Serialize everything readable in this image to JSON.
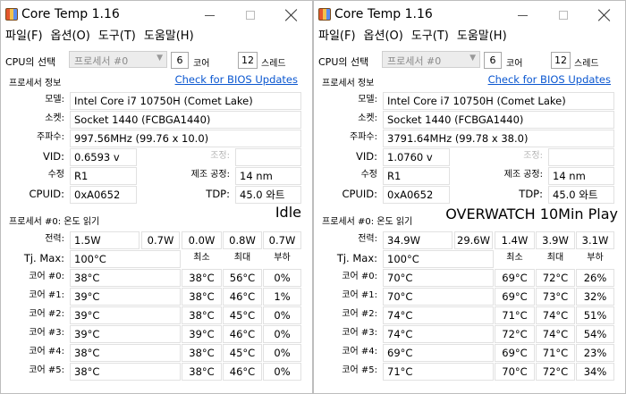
{
  "windows": [
    {
      "title": "Core Temp 1.16",
      "menu": [
        "파일(F)",
        "옵션(O)",
        "도구(T)",
        "도움말(H)"
      ],
      "cpu_select_label": "CPU의 선택",
      "cpu_select_value": "프로세서 #0",
      "cores_value": "6",
      "cores_label": "코어",
      "threads_value": "12",
      "threads_label": "스레드",
      "processor_info_label": "프로세서 정보",
      "bios_link": "Check for BIOS Updates",
      "model_label": "모델:",
      "model_value": "Intel Core i7 10750H (Comet Lake)",
      "socket_label": "소켓:",
      "socket_value": "Socket 1440 (FCBGA1440)",
      "freq_label": "주파수:",
      "freq_value": "997.56MHz (99.76 x 10.0)",
      "vid_label": "VID:",
      "vid_value": "0.6593 v",
      "rev_label": "수정",
      "rev_value": "R1",
      "cpuid_label": "CPUID:",
      "cpuid_value": "0xA0652",
      "modulation_label": "조정:",
      "modulation_value": "",
      "process_label": "제조 공정:",
      "process_value": "14 nm",
      "tdp_label": "TDP:",
      "tdp_value": "45.0 와트",
      "temp_section_label": "프로세서 #0: 온도 읽기",
      "power_label": "전력:",
      "power_values": [
        "1.5W",
        "0.7W",
        "0.0W",
        "0.8W",
        "0.7W"
      ],
      "tjmax_label": "Tj. Max:",
      "tjmax_value": "100°C",
      "col_min": "최소",
      "col_max": "최대",
      "col_load": "부하",
      "cores": [
        {
          "label": "코어 #0:",
          "temp": "38°C",
          "min": "38°C",
          "max": "56°C",
          "load": "0%"
        },
        {
          "label": "코어 #1:",
          "temp": "39°C",
          "min": "38°C",
          "max": "46°C",
          "load": "1%"
        },
        {
          "label": "코어 #2:",
          "temp": "39°C",
          "min": "38°C",
          "max": "45°C",
          "load": "0%"
        },
        {
          "label": "코어 #3:",
          "temp": "39°C",
          "min": "39°C",
          "max": "46°C",
          "load": "0%"
        },
        {
          "label": "코어 #4:",
          "temp": "38°C",
          "min": "38°C",
          "max": "45°C",
          "load": "0%"
        },
        {
          "label": "코어 #5:",
          "temp": "38°C",
          "min": "38°C",
          "max": "46°C",
          "load": "0%"
        }
      ],
      "overlay_label": "Idle"
    },
    {
      "title": "Core Temp 1.16",
      "menu": [
        "파일(F)",
        "옵션(O)",
        "도구(T)",
        "도움말(H)"
      ],
      "cpu_select_label": "CPU의 선택",
      "cpu_select_value": "프로세서 #0",
      "cores_value": "6",
      "cores_label": "코어",
      "threads_value": "12",
      "threads_label": "스레드",
      "processor_info_label": "프로세서 정보",
      "bios_link": "Check for BIOS Updates",
      "model_label": "모델:",
      "model_value": "Intel Core i7 10750H (Comet Lake)",
      "socket_label": "소켓:",
      "socket_value": "Socket 1440 (FCBGA1440)",
      "freq_label": "주파수:",
      "freq_value": "3791.64MHz (99.78 x 38.0)",
      "vid_label": "VID:",
      "vid_value": "1.0760 v",
      "rev_label": "수정",
      "rev_value": "R1",
      "cpuid_label": "CPUID:",
      "cpuid_value": "0xA0652",
      "modulation_label": "조정:",
      "modulation_value": "",
      "process_label": "제조 공정:",
      "process_value": "14 nm",
      "tdp_label": "TDP:",
      "tdp_value": "45.0 와트",
      "temp_section_label": "프로세서 #0: 온도 읽기",
      "power_label": "전력:",
      "power_values": [
        "34.9W",
        "29.6W",
        "1.4W",
        "3.9W",
        "3.1W"
      ],
      "tjmax_label": "Tj. Max:",
      "tjmax_value": "100°C",
      "col_min": "최소",
      "col_max": "최대",
      "col_load": "부하",
      "cores": [
        {
          "label": "코어 #0:",
          "temp": "70°C",
          "min": "69°C",
          "max": "72°C",
          "load": "26%"
        },
        {
          "label": "코어 #1:",
          "temp": "70°C",
          "min": "69°C",
          "max": "73°C",
          "load": "32%"
        },
        {
          "label": "코어 #2:",
          "temp": "74°C",
          "min": "71°C",
          "max": "74°C",
          "load": "51%"
        },
        {
          "label": "코어 #3:",
          "temp": "74°C",
          "min": "72°C",
          "max": "74°C",
          "load": "54%"
        },
        {
          "label": "코어 #4:",
          "temp": "69°C",
          "min": "69°C",
          "max": "71°C",
          "load": "23%"
        },
        {
          "label": "코어 #5:",
          "temp": "71°C",
          "min": "70°C",
          "max": "72°C",
          "load": "34%"
        }
      ],
      "overlay_label": "OVERWATCH 10Min Play"
    }
  ]
}
